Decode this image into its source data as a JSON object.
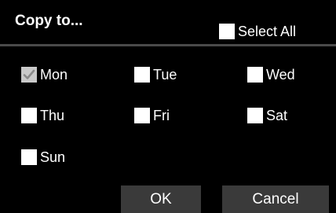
{
  "dialog": {
    "title": "Copy to...",
    "select_all": {
      "label": "Select All",
      "checked": false
    },
    "days": [
      {
        "label": "Mon",
        "checked": true
      },
      {
        "label": "Tue",
        "checked": false
      },
      {
        "label": "Wed",
        "checked": false
      },
      {
        "label": "Thu",
        "checked": false
      },
      {
        "label": "Fri",
        "checked": false
      },
      {
        "label": "Sat",
        "checked": false
      },
      {
        "label": "Sun",
        "checked": false
      }
    ],
    "ok_label": "OK",
    "cancel_label": "Cancel"
  },
  "colors": {
    "background": "#000000",
    "divider": "#4a4a4a",
    "button_bg": "#3a3a3a",
    "checkbox_unchecked": "#ffffff",
    "checkbox_checked": "#c9c9c9",
    "checkmark": "#8a8a8a"
  }
}
